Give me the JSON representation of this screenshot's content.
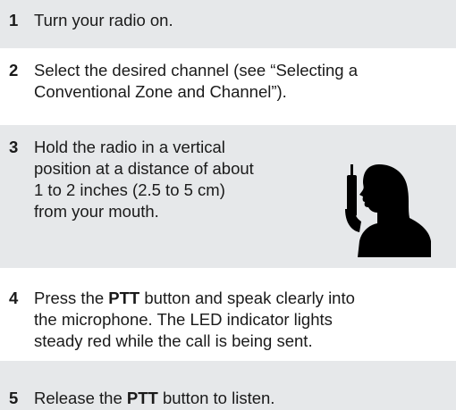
{
  "steps": [
    {
      "number": "1",
      "lines": [
        "Turn your radio on."
      ]
    },
    {
      "number": "2",
      "lines": [
        "Select the desired channel (see “Selecting a",
        "Conventional Zone and Channel”)."
      ]
    },
    {
      "number": "3",
      "lines": [
        "Hold the radio in a vertical",
        "position at a distance of about",
        "1 to 2 inches (2.5 to 5 cm)",
        "from your mouth."
      ]
    },
    {
      "number": "4",
      "line1_before": "Press the ",
      "line1_bold": "PTT",
      "line1_after": " button and speak clearly into",
      "lines": [
        "the microphone. The LED indicator lights",
        "steady red while the call is being sent."
      ]
    },
    {
      "number": "5",
      "line1_before": "Release the ",
      "line1_bold": "PTT",
      "line1_after": " button to listen."
    }
  ],
  "colors": {
    "band": "#e6e8ea",
    "text": "#1a1a1a",
    "silhouette": "#000000"
  },
  "figure": {
    "icon": "person-speaking-into-radio-icon"
  }
}
